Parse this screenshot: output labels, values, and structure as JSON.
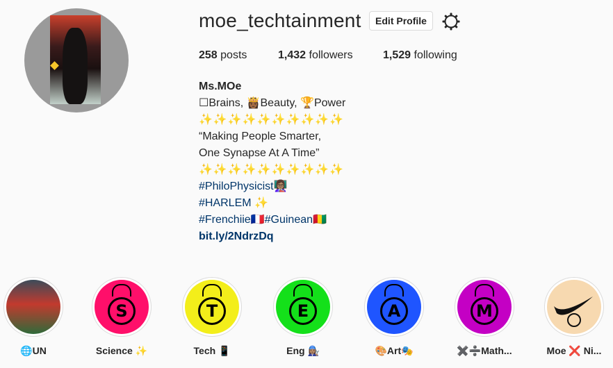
{
  "profile": {
    "username": "moe_techtainment",
    "edit_label": "Edit Profile"
  },
  "stats": {
    "posts_count": "258",
    "posts_label": "posts",
    "followers_count": "1,432",
    "followers_label": "followers",
    "following_count": "1,529",
    "following_label": "following"
  },
  "bio": {
    "name": "Ms.MOe",
    "lines": [
      "☐Brains, 👸🏾Beauty, 🏆Power",
      "✨✨✨✨✨✨✨✨✨✨",
      "“Making People Smarter,",
      "One Synapse At A Time”",
      "✨✨✨✨✨✨✨✨✨✨"
    ],
    "tag_philo": "#PhiloPhysicist👩🏽‍🏫",
    "tag_harlem": "#HARLEM ✨",
    "tag_frenchie": "#Frenchiie🇫🇷#Guinean🇬🇳",
    "link": "bit.ly/2NdrzDq"
  },
  "highlights": [
    {
      "label": "🌐UN",
      "color": "#6a7b6d",
      "letter": ""
    },
    {
      "label": "Science ✨",
      "color": "#ff0f6a",
      "letter": "S"
    },
    {
      "label": "Tech 📱",
      "color": "#f3ee1a",
      "letter": "T"
    },
    {
      "label": "Eng 👩🏽‍🔧",
      "color": "#14e01a",
      "letter": "E"
    },
    {
      "label": "🎨Art🎭",
      "color": "#1f55ff",
      "letter": "A"
    },
    {
      "label": "✖️➗Math...",
      "color": "#c400c4",
      "letter": "M"
    },
    {
      "label": "Moe ❌ Ni...",
      "color": "#f7d9b0",
      "letter": ""
    }
  ],
  "colors": {
    "link_blue": "#003569",
    "border": "#dbdbdb",
    "background": "#fafafa"
  },
  "icons": [
    "settings-gear-icon"
  ]
}
